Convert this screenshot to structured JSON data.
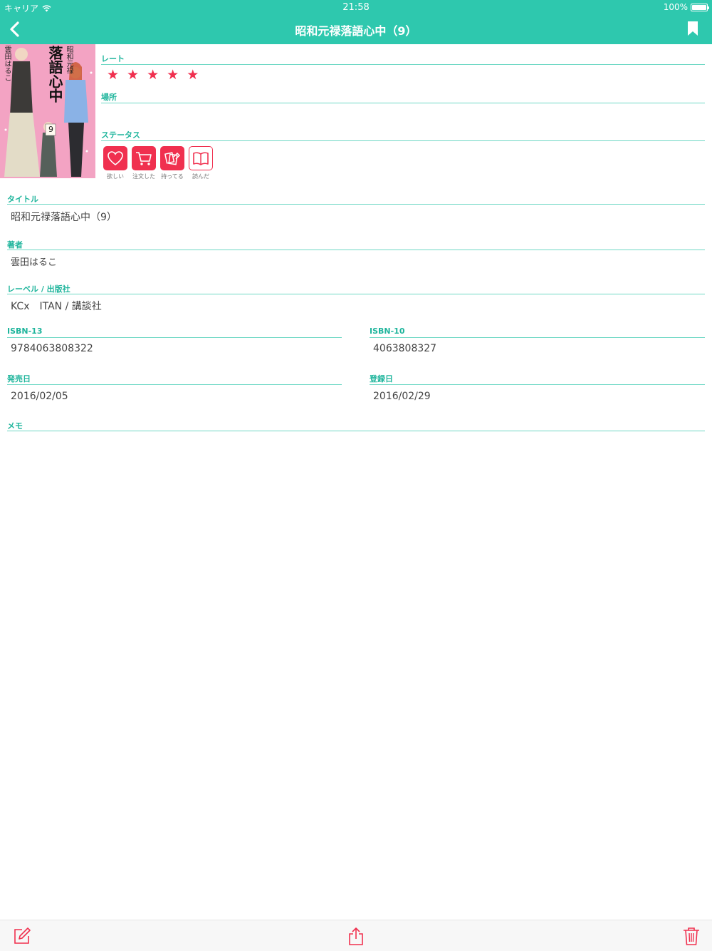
{
  "status_bar": {
    "carrier": "キャリア",
    "time": "21:58",
    "battery": "100%"
  },
  "nav": {
    "title": "昭和元禄落語心中（9）"
  },
  "book": {
    "rate_label": "レート",
    "rating": 5,
    "stars": [
      "★",
      "★",
      "★",
      "★",
      "★"
    ],
    "location_label": "場所",
    "location": "",
    "status_label": "ステータス",
    "statuses": [
      {
        "label": "欲しい",
        "icon": "heart-icon",
        "active": true
      },
      {
        "label": "注文した",
        "icon": "cart-icon",
        "active": true
      },
      {
        "label": "持ってる",
        "icon": "books-icon",
        "active": true
      },
      {
        "label": "読んだ",
        "icon": "open-book-icon",
        "active": false
      }
    ],
    "title_label": "タイトル",
    "title": "昭和元禄落語心中（9）",
    "author_label": "著者",
    "author": "雲田はるこ",
    "publisher_label": "レーベル / 出版社",
    "publisher": "KCx　ITAN / 講談社",
    "isbn13_label": "ISBN-13",
    "isbn13": "9784063808322",
    "isbn10_label": "ISBN-10",
    "isbn10": "4063808327",
    "release_label": "発売日",
    "release_date": "2016/02/05",
    "registered_label": "登録日",
    "registered_date": "2016/02/29",
    "memo_label": "メモ",
    "memo": ""
  },
  "cover": {
    "title_text": "落語心中",
    "series_text": "昭和元禄",
    "author_text": "雲田はるこ",
    "volume": "9"
  },
  "toolbar": {
    "edit_icon": "edit-icon",
    "share_icon": "share-icon",
    "delete_icon": "trash-icon"
  },
  "colors": {
    "accent": "#2ec8ae",
    "accent_text": "#1fb59c",
    "line": "#6fd8c5",
    "star": "#f0304f"
  }
}
